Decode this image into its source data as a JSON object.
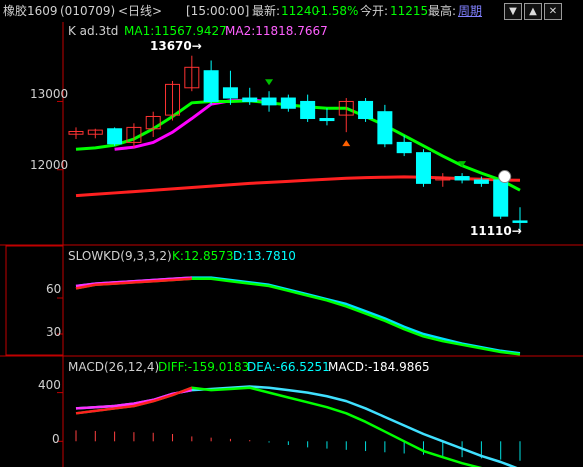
{
  "topbar": {
    "symbol": "橡胶1609",
    "code": "(010709)",
    "period": "<日线>",
    "time": "[15:00:00]",
    "latest_label": "最新:",
    "latest_value": "11240",
    "change_pct": "-1.58%",
    "open_label": "今开:",
    "open_value": "11215",
    "high_label": "最高:",
    "high_value": "周期",
    "btn_down": "▼",
    "btn_up": "▲",
    "btn_x": "✕"
  },
  "main_panel": {
    "title": "K  ad.3td",
    "ma1": "MA1:11567.9427",
    "ma2": "MA2:11818.7667",
    "high_annot": "13670→",
    "low_annot": "11110→",
    "y_ticks": [
      "13000",
      "12000"
    ],
    "ylim": [
      11000,
      13900
    ]
  },
  "kd_panel": {
    "title": "SLOWKD(9,3,3,2)",
    "k": "K:12.8573",
    "d": "D:13.7810",
    "y_ticks": [
      "60",
      "30"
    ]
  },
  "macd_panel": {
    "title": "MACD(26,12,4)",
    "diff": "DIFF:-159.0183",
    "dea": "DEA:-66.5251",
    "macd": "MACD:-184.9865",
    "y_ticks": [
      "400",
      "0"
    ]
  },
  "colors": {
    "up": "#ff3232",
    "down": "#00ffff",
    "ma1": "#00ff00",
    "ma2": "#ff00ff",
    "long_ma": "#ff2020",
    "axis": "#c00000",
    "label_yellow": "#ffff00",
    "label_green": "#00ff00",
    "label_cyan": "#00ffff"
  },
  "chart_data": {
    "type": "candlestick",
    "candles": [
      {
        "o": 12520,
        "h": 12620,
        "l": 12450,
        "c": 12560
      },
      {
        "o": 12520,
        "h": 12600,
        "l": 12460,
        "c": 12580
      },
      {
        "o": 12600,
        "h": 12620,
        "l": 12350,
        "c": 12380
      },
      {
        "o": 12400,
        "h": 12680,
        "l": 12320,
        "c": 12620
      },
      {
        "o": 12600,
        "h": 12850,
        "l": 12480,
        "c": 12780
      },
      {
        "o": 12800,
        "h": 13300,
        "l": 12720,
        "c": 13250
      },
      {
        "o": 13200,
        "h": 13670,
        "l": 13150,
        "c": 13500
      },
      {
        "o": 13450,
        "h": 13600,
        "l": 12950,
        "c": 13000
      },
      {
        "o": 13200,
        "h": 13450,
        "l": 12950,
        "c": 13050
      },
      {
        "o": 13050,
        "h": 13200,
        "l": 12950,
        "c": 13000
      },
      {
        "o": 13050,
        "h": 13150,
        "l": 12850,
        "c": 12950
      },
      {
        "o": 13050,
        "h": 13100,
        "l": 12850,
        "c": 12900
      },
      {
        "o": 13000,
        "h": 13100,
        "l": 12700,
        "c": 12750
      },
      {
        "o": 12750,
        "h": 12900,
        "l": 12650,
        "c": 12720
      },
      {
        "o": 12800,
        "h": 13050,
        "l": 12550,
        "c": 13000
      },
      {
        "o": 13000,
        "h": 13050,
        "l": 12700,
        "c": 12750
      },
      {
        "o": 12850,
        "h": 12950,
        "l": 12330,
        "c": 12380
      },
      {
        "o": 12400,
        "h": 12500,
        "l": 12200,
        "c": 12250
      },
      {
        "o": 12250,
        "h": 12300,
        "l": 11750,
        "c": 11800
      },
      {
        "o": 11850,
        "h": 11950,
        "l": 11750,
        "c": 11880
      },
      {
        "o": 11900,
        "h": 11950,
        "l": 11800,
        "c": 11850
      },
      {
        "o": 11850,
        "h": 11900,
        "l": 11750,
        "c": 11800
      },
      {
        "o": 11850,
        "h": 11900,
        "l": 11280,
        "c": 11320
      },
      {
        "o": 11250,
        "h": 11450,
        "l": 11100,
        "c": 11240
      }
    ],
    "ma1": [
      12300,
      12320,
      12360,
      12450,
      12600,
      12780,
      12980,
      13000,
      13000,
      13010,
      12980,
      12950,
      12920,
      12900,
      12900,
      12780,
      12650,
      12500,
      12350,
      12200,
      12060,
      11950,
      11850,
      11700
    ],
    "ma2": [
      null,
      null,
      12300,
      12330,
      12400,
      12550,
      12750,
      12960,
      13010,
      13020,
      13000,
      null,
      null,
      null,
      null,
      null,
      null,
      null,
      null,
      null,
      null,
      null,
      null,
      null
    ],
    "long_ma": [
      11620,
      11640,
      11660,
      11680,
      11700,
      11720,
      11740,
      11760,
      11780,
      11800,
      11815,
      11830,
      11845,
      11860,
      11875,
      11885,
      11890,
      11895,
      11890,
      11880,
      11870,
      11860,
      11850,
      11845
    ],
    "kd_k": [
      68,
      71,
      72,
      73,
      74,
      75,
      76,
      76,
      74,
      72,
      70,
      66,
      62,
      58,
      53,
      47,
      41,
      34,
      28,
      24,
      21,
      18,
      15,
      13
    ],
    "kd_d": [
      70,
      72,
      73,
      74,
      75,
      76,
      77,
      77,
      75,
      73,
      71,
      67,
      63,
      59,
      55,
      49,
      43,
      36,
      30,
      26,
      22,
      19,
      16,
      14
    ],
    "kd_ylim": [
      15,
      90
    ],
    "macd_diff": [
      230,
      250,
      270,
      290,
      330,
      380,
      440,
      420,
      430,
      440,
      400,
      360,
      320,
      280,
      230,
      160,
      80,
      0,
      -80,
      -130,
      -180,
      -220,
      -260,
      -300
    ],
    "macd_dea": [
      270,
      280,
      290,
      310,
      340,
      390,
      420,
      430,
      440,
      450,
      440,
      420,
      400,
      370,
      330,
      270,
      200,
      130,
      60,
      0,
      -60,
      -120,
      -170,
      -230
    ],
    "macd_hist": [
      90,
      85,
      80,
      75,
      70,
      60,
      40,
      30,
      20,
      10,
      -10,
      -30,
      -50,
      -60,
      -70,
      -80,
      -90,
      -100,
      -110,
      -120,
      -130,
      -140,
      -150,
      -160
    ],
    "macd_ylim": [
      -170,
      520
    ]
  }
}
